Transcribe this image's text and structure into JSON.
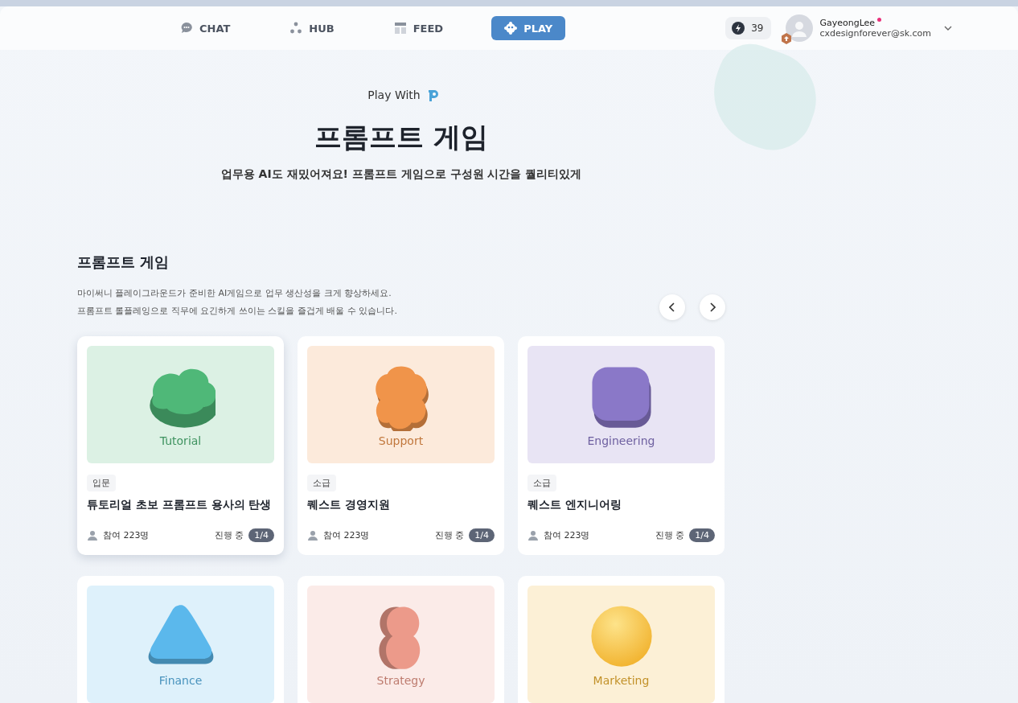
{
  "nav": {
    "tabs": [
      {
        "label": "CHAT",
        "selected": false
      },
      {
        "label": "HUB",
        "selected": false
      },
      {
        "label": "FEED",
        "selected": false
      },
      {
        "label": "PLAY",
        "selected": true
      }
    ]
  },
  "user": {
    "points": "39",
    "name": "GayeongLee",
    "email": "cxdesignforever@sk.com",
    "notification": true
  },
  "hero": {
    "kicker": "Play With",
    "title": "프롬프트 게임",
    "subtitle": "업무용 AI도 재밌어져요! 프롬프트 게임으로 구성원 시간을 퀄리티있게"
  },
  "section": {
    "title": "프롬프트 게임",
    "description": [
      "마이써니 플레이그라운드가 준비한 AI게임으로 업무 생산성을 크게 향상하세요.",
      "프롬프트 롤플레잉으로 직무에 요긴하게 쓰이는 스킬을 즐겁게 배울 수 있습니다."
    ]
  },
  "cards": [
    {
      "category": "Tutorial",
      "kind": "blob",
      "color": "#4fb878",
      "level": "입문",
      "title": "튜토리얼 초보 프롬프트 용사의 탄생",
      "participants": "참여 223명",
      "status": "진행 중",
      "progress": "1/4",
      "selected": true
    },
    {
      "category": "Support",
      "kind": "flower",
      "color": "#f0944a",
      "level": "소급",
      "title": "퀘스트 경영지원",
      "participants": "참여 223명",
      "status": "진행 중",
      "progress": "1/4",
      "selected": false
    },
    {
      "category": "Engineering",
      "kind": "squircle",
      "color": "#8a78c8",
      "level": "소급",
      "title": "퀘스트 엔지니어링",
      "participants": "참여 223명",
      "status": "진행 중",
      "progress": "1/4",
      "selected": false
    },
    {
      "category": "Finance",
      "kind": "triangle",
      "color": "#5bb8ec",
      "selected": false
    },
    {
      "category": "Strategy",
      "kind": "eight",
      "color": "#ec9a8a",
      "selected": false
    },
    {
      "category": "Marketing",
      "kind": "sphere",
      "color": "#f2b533",
      "selected": false
    }
  ]
}
